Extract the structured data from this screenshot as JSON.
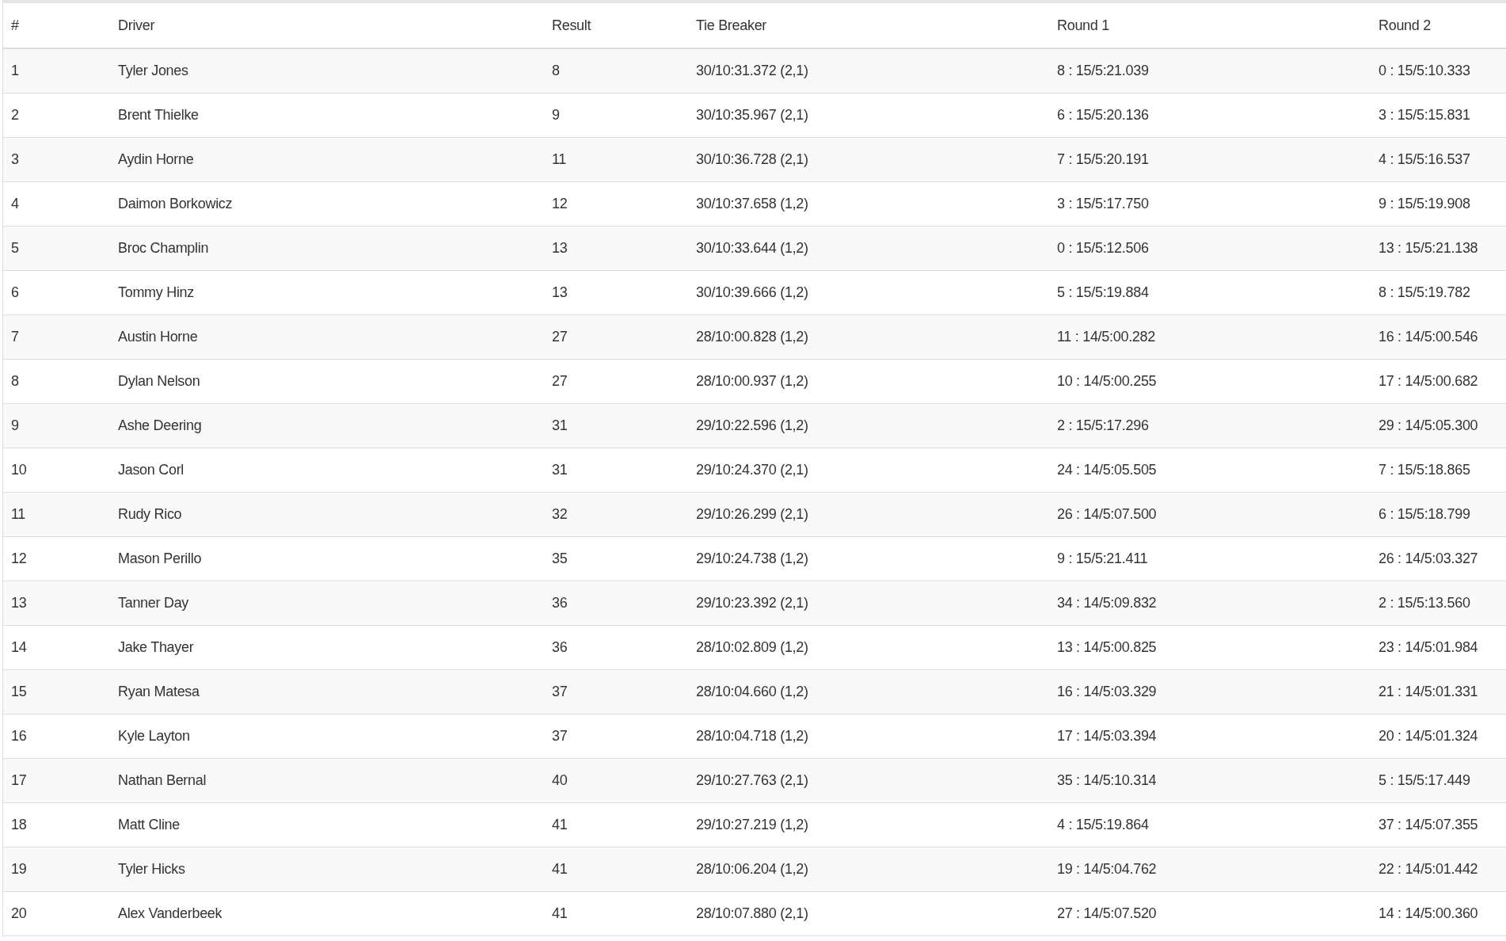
{
  "table": {
    "columns": [
      "#",
      "Driver",
      "Result",
      "Tie Breaker",
      "Round 1",
      "Round 2"
    ],
    "rows": [
      [
        "1",
        "Tyler Jones",
        "8",
        "30/10:31.372 (2,1)",
        "8 : 15/5:21.039",
        "0 : 15/5:10.333"
      ],
      [
        "2",
        "Brent Thielke",
        "9",
        "30/10:35.967 (2,1)",
        "6 : 15/5:20.136",
        "3 : 15/5:15.831"
      ],
      [
        "3",
        "Aydin Horne",
        "11",
        "30/10:36.728 (2,1)",
        "7 : 15/5:20.191",
        "4 : 15/5:16.537"
      ],
      [
        "4",
        "Daimon Borkowicz",
        "12",
        "30/10:37.658 (1,2)",
        "3 : 15/5:17.750",
        "9 : 15/5:19.908"
      ],
      [
        "5",
        "Broc Champlin",
        "13",
        "30/10:33.644 (1,2)",
        "0 : 15/5:12.506",
        "13 : 15/5:21.138"
      ],
      [
        "6",
        "Tommy Hinz",
        "13",
        "30/10:39.666 (1,2)",
        "5 : 15/5:19.884",
        "8 : 15/5:19.782"
      ],
      [
        "7",
        "Austin Horne",
        "27",
        "28/10:00.828 (1,2)",
        "11 : 14/5:00.282",
        "16 : 14/5:00.546"
      ],
      [
        "8",
        "Dylan Nelson",
        "27",
        "28/10:00.937 (1,2)",
        "10 : 14/5:00.255",
        "17 : 14/5:00.682"
      ],
      [
        "9",
        "Ashe Deering",
        "31",
        "29/10:22.596 (1,2)",
        "2 : 15/5:17.296",
        "29 : 14/5:05.300"
      ],
      [
        "10",
        "Jason Corl",
        "31",
        "29/10:24.370 (2,1)",
        "24 : 14/5:05.505",
        "7 : 15/5:18.865"
      ],
      [
        "11",
        "Rudy Rico",
        "32",
        "29/10:26.299 (2,1)",
        "26 : 14/5:07.500",
        "6 : 15/5:18.799"
      ],
      [
        "12",
        "Mason Perillo",
        "35",
        "29/10:24.738 (1,2)",
        "9 : 15/5:21.411",
        "26 : 14/5:03.327"
      ],
      [
        "13",
        "Tanner Day",
        "36",
        "29/10:23.392 (2,1)",
        "34 : 14/5:09.832",
        "2 : 15/5:13.560"
      ],
      [
        "14",
        "Jake Thayer",
        "36",
        "28/10:02.809 (1,2)",
        "13 : 14/5:00.825",
        "23 : 14/5:01.984"
      ],
      [
        "15",
        "Ryan Matesa",
        "37",
        "28/10:04.660 (1,2)",
        "16 : 14/5:03.329",
        "21 : 14/5:01.331"
      ],
      [
        "16",
        "Kyle Layton",
        "37",
        "28/10:04.718 (1,2)",
        "17 : 14/5:03.394",
        "20 : 14/5:01.324"
      ],
      [
        "17",
        "Nathan Bernal",
        "40",
        "29/10:27.763 (2,1)",
        "35 : 14/5:10.314",
        "5 : 15/5:17.449"
      ],
      [
        "18",
        "Matt Cline",
        "41",
        "29/10:27.219 (1,2)",
        "4 : 15/5:19.864",
        "37 : 14/5:07.355"
      ],
      [
        "19",
        "Tyler Hicks",
        "41",
        "28/10:06.204 (1,2)",
        "19 : 14/5:04.762",
        "22 : 14/5:01.442"
      ],
      [
        "20",
        "Alex Vanderbeek",
        "41",
        "28/10:07.880 (2,1)",
        "27 : 14/5:07.520",
        "14 : 14/5:00.360"
      ]
    ]
  }
}
